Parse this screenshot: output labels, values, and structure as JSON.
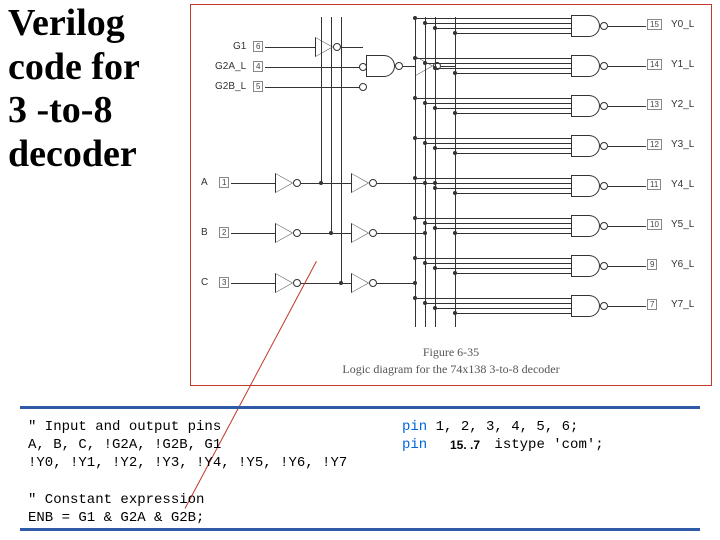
{
  "title_lines": [
    "Verilog",
    "code for",
    "3 -to-8",
    "decoder"
  ],
  "inputs": {
    "enables": [
      {
        "name": "G1",
        "pin": "6"
      },
      {
        "name": "G2A_L",
        "pin": "4"
      },
      {
        "name": "G2B_L",
        "pin": "5"
      }
    ],
    "selects": [
      {
        "name": "A",
        "pin": "1"
      },
      {
        "name": "B",
        "pin": "2"
      },
      {
        "name": "C",
        "pin": "3"
      }
    ]
  },
  "outputs": [
    {
      "name": "Y0_L",
      "pin": "15"
    },
    {
      "name": "Y1_L",
      "pin": "14"
    },
    {
      "name": "Y2_L",
      "pin": "13"
    },
    {
      "name": "Y3_L",
      "pin": "12"
    },
    {
      "name": "Y4_L",
      "pin": "11"
    },
    {
      "name": "Y5_L",
      "pin": "10"
    },
    {
      "name": "Y6_L",
      "pin": "9"
    },
    {
      "name": "Y7_L",
      "pin": "7"
    }
  ],
  "figure": {
    "number": "Figure 6-35",
    "caption": "Logic diagram for the 74x138 3-to-8 decoder"
  },
  "code_left": "\" Input and output pins\nA, B, C, !G2A, !G2B, G1\n!Y0, !Y1, !Y2, !Y3, !Y4, !Y5, !Y6, !Y7\n\n\" Constant expression\nENB = G1 & G2A & G2B;",
  "code_right_line1_pre": "pin",
  "code_right_line1_post": " 1, 2, 3, 4, 5, 6;",
  "code_right_line2_pre": "pin",
  "code_right_line2_mid": "       ",
  "code_right_line2_post": " istype 'com';",
  "page_number": "15. .7"
}
